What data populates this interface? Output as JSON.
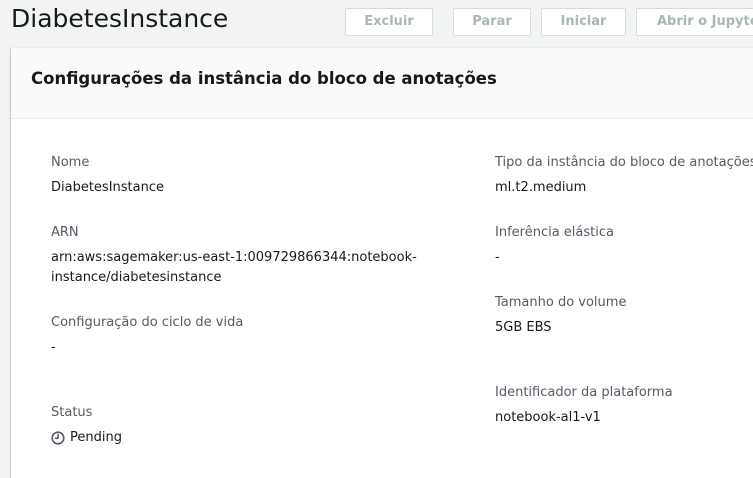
{
  "page": {
    "title": "DiabetesInstance"
  },
  "actions": {
    "delete_label": "Excluir",
    "stop_label": "Parar",
    "start_label": "Iniciar",
    "open_jupyter_label": "Abrir o Jupyter"
  },
  "panel": {
    "title": "Configurações da instância do bloco de anotações"
  },
  "fields": {
    "name": {
      "label": "Nome",
      "value": "DiabetesInstance"
    },
    "arn": {
      "label": "ARN",
      "value": "arn:aws:sagemaker:us-east-1:009729866344:notebook-instance/diabetesinstance"
    },
    "lifecycle": {
      "label": "Configuração do ciclo de vida",
      "value": "-"
    },
    "status": {
      "label": "Status",
      "value": "Pending",
      "icon": "clock-icon"
    },
    "instance_type": {
      "label": "Tipo da instância do bloco de anotações",
      "value": "ml.t2.medium"
    },
    "elastic_inference": {
      "label": "Inferência elástica",
      "value": "-"
    },
    "volume_size": {
      "label": "Tamanho do volume",
      "value": "5GB EBS"
    },
    "platform_id": {
      "label": "Identificador da plataforma",
      "value": "notebook-al1-v1"
    }
  },
  "colors": {
    "background": "#f2f3f3",
    "disabled_button_text": "#aab7b8",
    "label": "#545b64",
    "text": "#16191f"
  }
}
